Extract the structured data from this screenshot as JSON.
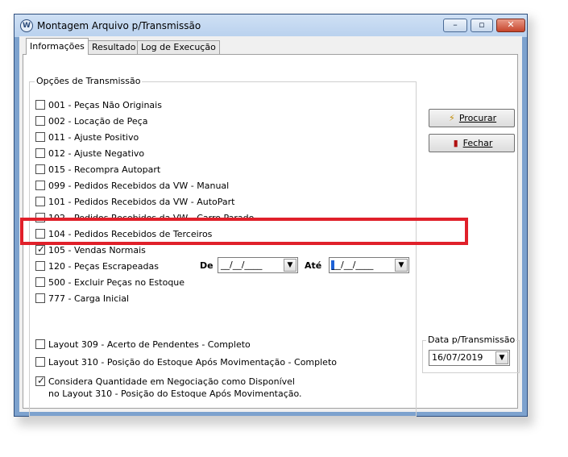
{
  "window": {
    "title": "Montagem Arquivo p/Transmissão",
    "min_label": "▭",
    "max_label": "□",
    "close_label": "✕"
  },
  "tabs": [
    {
      "label": "Informações"
    },
    {
      "label": "Resultado"
    },
    {
      "label": "Log de Execução"
    }
  ],
  "options_group": {
    "title": "Opções de Transmissão",
    "items": [
      {
        "label": "001 - Peças Não Originais",
        "checked": false
      },
      {
        "label": "002 - Locação de Peça",
        "checked": false
      },
      {
        "label": "011 - Ajuste Positivo",
        "checked": false
      },
      {
        "label": "012 - Ajuste Negativo",
        "checked": false
      },
      {
        "label": "015 - Recompra Autopart",
        "checked": false
      },
      {
        "label": "099 - Pedidos Recebidos da VW - Manual",
        "checked": false
      },
      {
        "label": "101 - Pedidos Recebidos da VW - AutoPart",
        "checked": false
      },
      {
        "label": "102 - Pedidos Recebidos da VW - Carro Parado",
        "checked": false
      },
      {
        "label": "104 - Pedidos Recebidos de Terceiros",
        "checked": false
      },
      {
        "label": "105 - Vendas Normais",
        "checked": true
      },
      {
        "label": "120 - Peças Escrapeadas",
        "checked": false
      },
      {
        "label": "500 - Excluir Peças no Estoque",
        "checked": false
      },
      {
        "label": "777 - Carga Inicial",
        "checked": false
      }
    ],
    "layouts": [
      {
        "label": "Layout 309 - Acerto de Pendentes - Completo",
        "checked": false
      },
      {
        "label": "Layout 310 - Posição do Estoque Após Movimentação - Completo",
        "checked": false
      }
    ],
    "considera": {
      "line1": "Considera Quantidade em Negociação como Disponível",
      "line2": "no Layout 310 - Posição do Estoque Após Movimentação.",
      "checked": true
    },
    "range": {
      "from_label": "De",
      "from_value": "__/__/____",
      "to_label": "Até",
      "to_value": "__/__/____"
    }
  },
  "buttons": {
    "procurar": "Procurar",
    "fechar": "Fechar"
  },
  "transmission_date": {
    "title": "Data p/Transmissão",
    "value": "16/07/2019"
  },
  "colors": {
    "highlight": "#e0202a",
    "accent": "#1e62d6"
  }
}
